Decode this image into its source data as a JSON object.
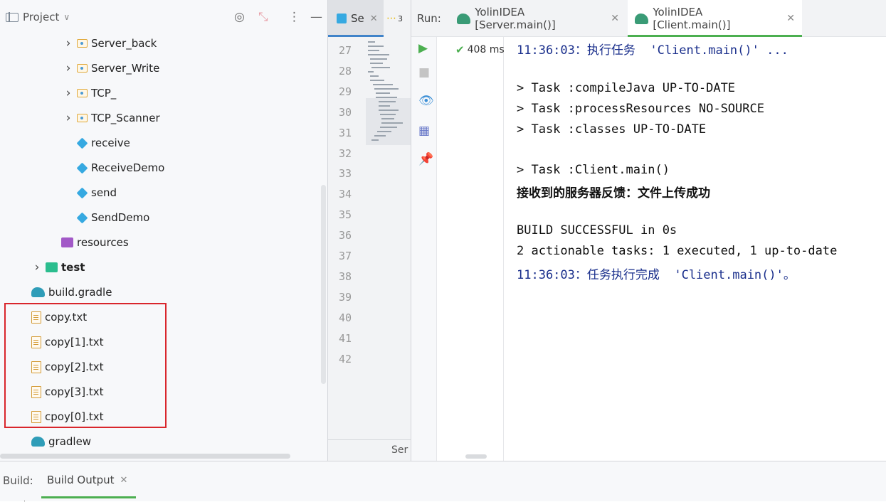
{
  "project": {
    "title": "Project",
    "tree": [
      {
        "label": "Server_back",
        "kind": "folder",
        "expandable": true
      },
      {
        "label": "Server_Write",
        "kind": "folder",
        "expandable": true
      },
      {
        "label": "TCP_",
        "kind": "folder",
        "expandable": true
      },
      {
        "label": "TCP_Scanner",
        "kind": "folder",
        "expandable": true
      },
      {
        "label": "receive",
        "kind": "class"
      },
      {
        "label": "ReceiveDemo",
        "kind": "class"
      },
      {
        "label": "send",
        "kind": "class"
      },
      {
        "label": "SendDemo",
        "kind": "class"
      },
      {
        "label": "resources",
        "kind": "resources-folder"
      },
      {
        "label": "test",
        "kind": "test-folder",
        "expandable": true
      },
      {
        "label": "build.gradle",
        "kind": "gradle"
      },
      {
        "label": "copy.txt",
        "kind": "text-file"
      },
      {
        "label": "copy[1].txt",
        "kind": "text-file"
      },
      {
        "label": "copy[2].txt",
        "kind": "text-file"
      },
      {
        "label": "copy[3].txt",
        "kind": "text-file"
      },
      {
        "label": "cpoy[0].txt",
        "kind": "text-file"
      },
      {
        "label": "gradlew",
        "kind": "gradle"
      }
    ]
  },
  "editor": {
    "tabs": [
      {
        "label": "Se",
        "active": true
      },
      {
        "label": "3",
        "active": false
      }
    ],
    "line_numbers": [
      "27",
      "28",
      "29",
      "30",
      "31",
      "32",
      "33",
      "34",
      "35",
      "36",
      "37",
      "38",
      "39",
      "40",
      "41",
      "42"
    ],
    "bottom_label": "Ser"
  },
  "run": {
    "label": "Run:",
    "tabs": [
      {
        "label": "YolinIDEA [Server.main()]",
        "active": false
      },
      {
        "label": "YolinIDEA [Client.main()]",
        "active": true
      }
    ],
    "timing": "408 ms",
    "console": [
      {
        "text": "11:36:03：执行任务  'Client.main()' ...",
        "style": "blue"
      },
      {
        "text": "",
        "style": "plain"
      },
      {
        "text": "> Task :compileJava UP-TO-DATE",
        "style": "plain"
      },
      {
        "text": "> Task :processResources NO-SOURCE",
        "style": "plain"
      },
      {
        "text": "> Task :classes UP-TO-DATE",
        "style": "plain"
      },
      {
        "text": "",
        "style": "plain"
      },
      {
        "text": "> Task :Client.main()",
        "style": "plain"
      },
      {
        "text": "接收到的服务器反馈：文件上传成功",
        "style": "cn"
      },
      {
        "text": "",
        "style": "plain"
      },
      {
        "text": "BUILD SUCCESSFUL in 0s",
        "style": "plain"
      },
      {
        "text": "2 actionable tasks: 1 executed, 1 up-to-date",
        "style": "plain"
      },
      {
        "text": "11:36:03：任务执行完成  'Client.main()'。",
        "style": "blue"
      }
    ]
  },
  "build": {
    "label": "Build:",
    "tab": "Build Output"
  },
  "colors": {
    "highlight_box": "#d9262c",
    "active_tab_accent": "#4caf50",
    "editor_tab_accent": "#4083c9",
    "console_info": "#1a2f8c"
  },
  "icons": {
    "project_header": [
      "target-icon",
      "collapse-icon",
      "more-vertical-icon",
      "minimize-icon"
    ],
    "run_toolbar": [
      "run-icon",
      "stop-icon",
      "eye-icon",
      "layout-icon",
      "pin-icon"
    ],
    "status": "success-check-icon"
  }
}
